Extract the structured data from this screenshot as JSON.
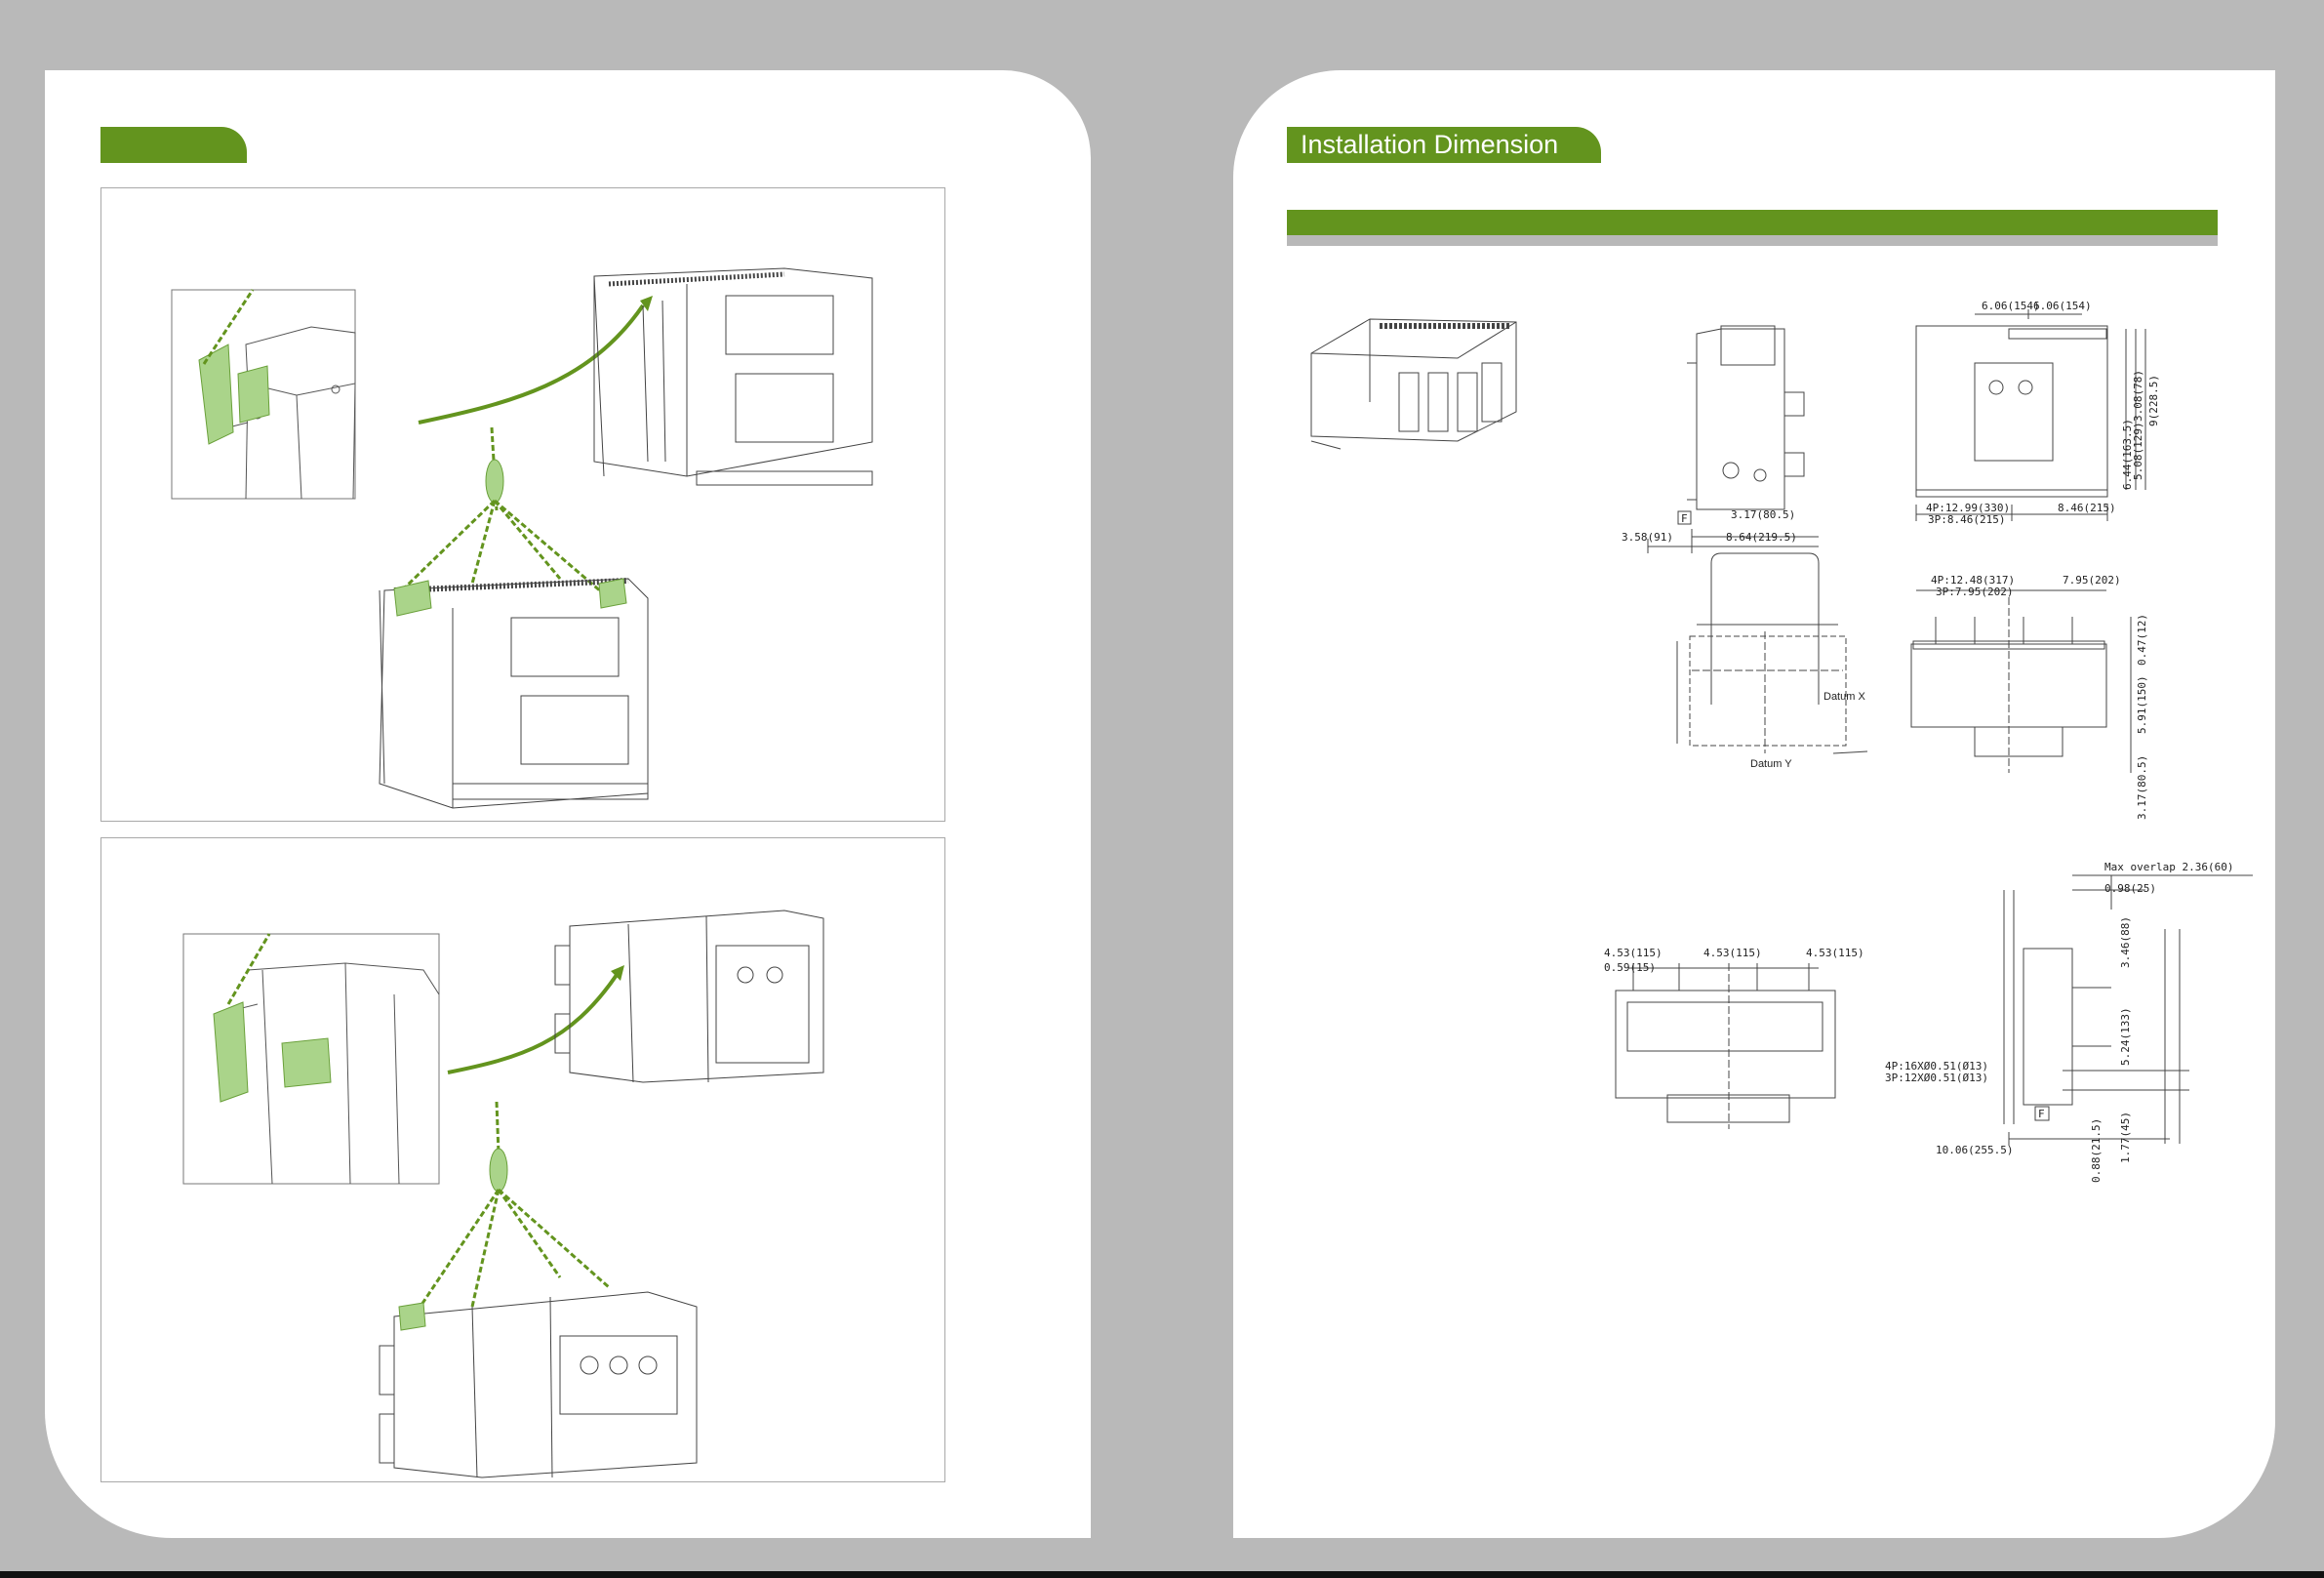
{
  "left_page": {
    "tab_label": ""
  },
  "right_page": {
    "section_title": "Installation Dimension",
    "dimensions": {
      "top_right": [
        "6.06(154)",
        "6.06(154)"
      ],
      "side_view": [
        "3.17(80.5)",
        "3.58(91)",
        "8.64(219.5)",
        "F"
      ],
      "front_view_bottom": [
        "4P:12.99(330)",
        "3P:8.46(215)",
        "8.46(215)"
      ],
      "front_view_right": [
        "9(228.5)",
        "3.08(78)",
        "5.08(129)",
        "6.44(163.5)"
      ],
      "cutout": [
        "Datum X",
        "Datum Y"
      ],
      "bottom_mount_top": [
        "4P:12.48(317)",
        "3P:7.95(202)",
        "7.95(202)"
      ],
      "bottom_mount_right": [
        "0.47(12)",
        "5.91(150)",
        "3.17(80.5)"
      ],
      "terminal_view": [
        "4.53(115)",
        "4.53(115)",
        "4.53(115)",
        "0.59(15)"
      ],
      "side_terminal": [
        "Max overlap 2.36(60)",
        "0.98(25)",
        "3.46(88)",
        "5.24(133)",
        "4P:16XØ0.51(Ø13)",
        "3P:12XØ0.51(Ø13)",
        "F",
        "10.06(255.5)",
        "1.77(45)",
        "0.88(21.5)"
      ]
    }
  },
  "colors": {
    "accent_green": "#63941e",
    "highlight_green": "#aad48a",
    "background": "#b9b9b9"
  }
}
